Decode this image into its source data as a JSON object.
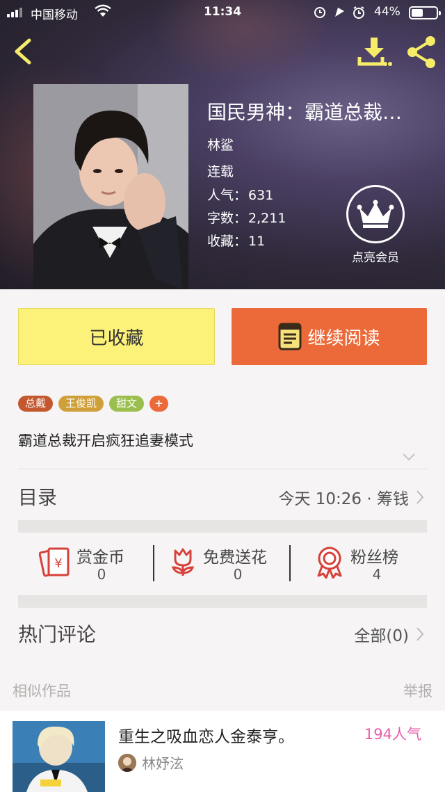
{
  "status_bar": {
    "carrier": "中国移动",
    "time": "11:34",
    "battery": "44%"
  },
  "colors": {
    "accent_orange": "#ec6a39",
    "collected_yellow": "#fcf27a",
    "popularity_pink": "#e75ca8",
    "icon_red": "#d6413a"
  },
  "nav": {
    "back_icon": "chevron-left-icon",
    "download_icon": "download-icon",
    "share_icon": "share-icon"
  },
  "book": {
    "title": "国民男神：霸道总裁…",
    "author": "林鲨",
    "status": "连载",
    "popularity_label": "人气：",
    "popularity": "631",
    "words_label": "字数：",
    "words": "2,211",
    "favorites_label": "收藏：",
    "favorites": "11"
  },
  "vip": {
    "label": "点亮会员",
    "icon": "crown-icon"
  },
  "actions": {
    "collected": "已收藏",
    "continue_reading": "继续阅读"
  },
  "tags": [
    {
      "label": "总戴",
      "color": "#c4572e"
    },
    {
      "label": "王俊凯",
      "color": "#cfa03a"
    },
    {
      "label": "甜文",
      "color": "#9bbf4e"
    },
    {
      "label": "+",
      "color": "#ec6a39"
    }
  ],
  "intro": "霸道总裁开启疯狂追妻模式",
  "catalog": {
    "title": "目录",
    "latest": "今天 10:26 · 筹钱"
  },
  "stats": [
    {
      "label": "赏金币",
      "value": "0",
      "icon": "red-envelope-icon"
    },
    {
      "label": "免费送花",
      "value": "0",
      "icon": "flower-icon"
    },
    {
      "label": "粉丝榜",
      "value": "4",
      "icon": "medal-icon"
    }
  ],
  "comments": {
    "title": "热门评论",
    "all": "全部(0)"
  },
  "similar": {
    "title": "相似作品",
    "report": "举报",
    "items": [
      {
        "title": "重生之吸血恋人金泰亨。",
        "popularity": "194人气",
        "author": "林妤泫"
      }
    ]
  }
}
